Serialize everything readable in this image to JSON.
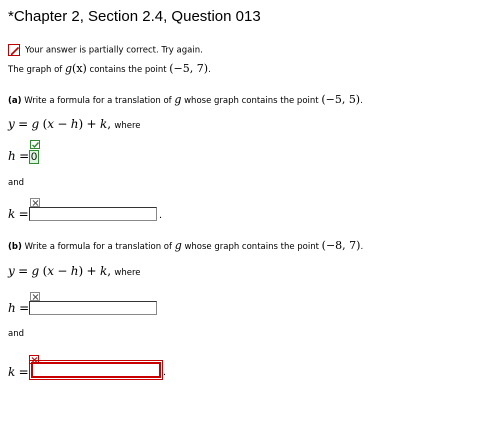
{
  "header": {
    "title": "*Chapter 2, Section 2.4, Question 013"
  },
  "status": {
    "icon": "pencil-icon",
    "message": "Your answer is partially correct.  Try again.",
    "color": "#c00000"
  },
  "problem": {
    "intro_text": "The graph of",
    "intro_func": "g",
    "intro_arg": "(x)",
    "intro_mid": "contains the point",
    "intro_point": "(−5, 7)",
    "intro_end": "."
  },
  "part_a": {
    "label": "(a)",
    "question": "Write a formula for a translation of",
    "question_func": "g",
    "question_mid": "whose graph contains the point",
    "point": "(−5, 5)",
    "end": ".",
    "eq_lhs": "y",
    "eq_eq": "=",
    "eq_g": "g",
    "eq_open": "(",
    "eq_x": "x",
    "eq_minus": "−",
    "eq_h": "h",
    "eq_close": ")",
    "eq_plus": "+",
    "eq_k": "k",
    "eq_comma": ",",
    "where": "where",
    "h_label": "h",
    "h_eq": "=",
    "h_value": "0",
    "h_status": "check-icon",
    "and": "and",
    "k_label": "k",
    "k_eq": "=",
    "k_value": "",
    "k_status": "x-mark-icon",
    "k_period": "."
  },
  "part_b": {
    "label": "(b)",
    "question": "Write a formula for a translation of",
    "question_func": "g",
    "question_mid": "whose graph contains the point",
    "point": "(−8, 7)",
    "end": ".",
    "eq_lhs": "y",
    "eq_eq": "=",
    "eq_g": "g",
    "eq_open": "(",
    "eq_x": "x",
    "eq_minus": "−",
    "eq_h": "h",
    "eq_close": ")",
    "eq_plus": "+",
    "eq_k": "k",
    "eq_comma": ",",
    "where": "where",
    "h_label": "h",
    "h_eq": "=",
    "h_value": "",
    "h_status": "x-mark-icon",
    "and": "and",
    "k_label": "k",
    "k_eq": "=",
    "k_value": "",
    "k_status": "x-mark-icon",
    "k_period": "."
  },
  "colors": {
    "error": "#c80000",
    "correct": "#2e8b2e"
  }
}
